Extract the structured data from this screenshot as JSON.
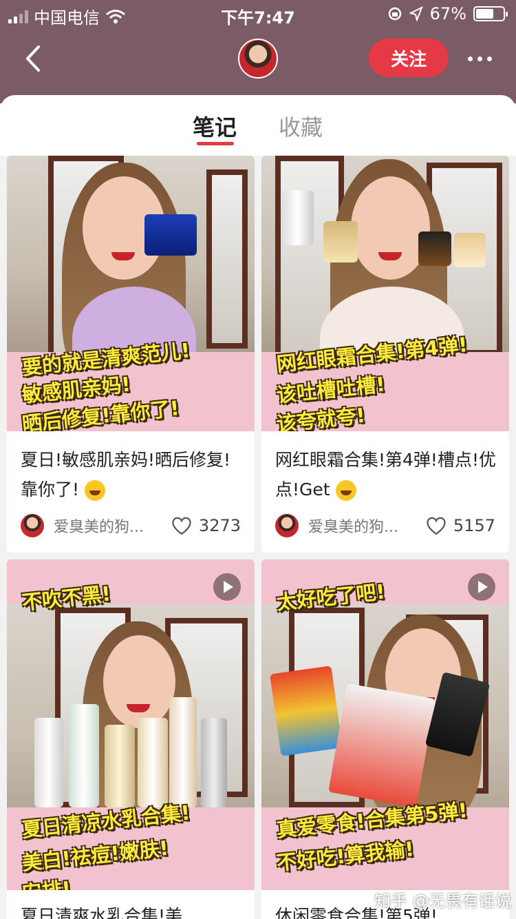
{
  "status_bar": {
    "carrier": "中国电信",
    "time": "下午7:47",
    "battery": "67%",
    "battery_level": 0.67
  },
  "header": {
    "follow_label": "关注"
  },
  "tabs": [
    {
      "label": "笔记",
      "active": true
    },
    {
      "label": "收藏",
      "active": false
    }
  ],
  "cards": [
    {
      "captions": [
        "要的就是清爽范儿!",
        "敏感肌亲妈!",
        "晒后修复!靠你了!"
      ],
      "title": "夏日!敏感肌亲妈!晒后修复!靠你了!",
      "author": "爱臭美的狗...",
      "likes": "3273",
      "is_video": false
    },
    {
      "captions": [
        "网红眼霜合集!第4弹!",
        "该吐槽吐槽!",
        "该夸就夸!"
      ],
      "title": "网红眼霜合集!第4弹!槽点!优点!Get",
      "author": "爱臭美的狗...",
      "likes": "5157",
      "is_video": false
    },
    {
      "captions": [
        "不吹不黑!",
        "夏日清凉水乳合集!",
        "美白!祛痘!嫩肤!",
        "安排!"
      ],
      "title": "夏日清爽水乳合集!美",
      "is_video": true
    },
    {
      "captions": [
        "太好吃了吧!",
        "真爱零食!合集第5弹!",
        "不好吃!算我输!"
      ],
      "title": "休闲零食合集!第5弹!",
      "is_video": true
    }
  ],
  "watermark": "知乎 @无畏有话说",
  "colors": {
    "header_bg": "#7b5b65",
    "accent": "#e63946",
    "caption_yellow": "#ffeb3b",
    "caption_band": "#f3c2cf"
  },
  "icons": [
    "signal-icon",
    "wifi-icon",
    "orientation-lock-icon",
    "location-icon",
    "battery-icon",
    "back-arrow-icon",
    "more-icon",
    "heart-icon",
    "play-icon"
  ]
}
